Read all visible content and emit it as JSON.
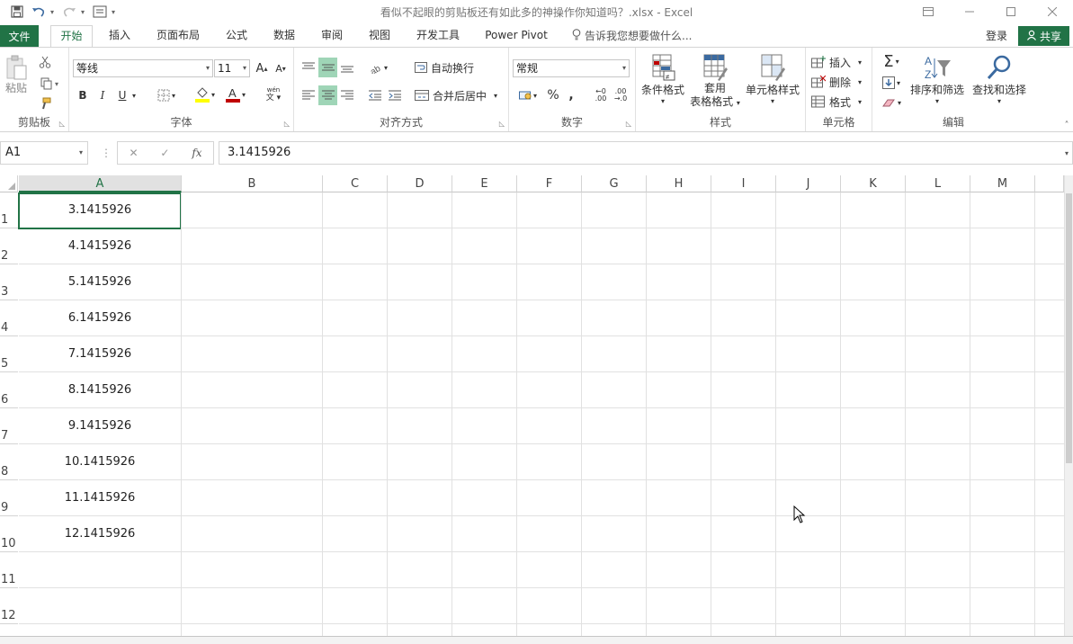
{
  "window": {
    "title": "看似不起眼的剪贴板还有如此多的神操作你知道吗？.xlsx - Excel"
  },
  "tabs": {
    "file": "文件",
    "items": [
      "开始",
      "插入",
      "页面布局",
      "公式",
      "数据",
      "审阅",
      "视图",
      "开发工具",
      "Power Pivot"
    ],
    "active_index": 0,
    "tell_me": "告诉我您想要做什么...",
    "login": "登录",
    "share": "共享"
  },
  "ribbon": {
    "clipboard": {
      "label": "剪贴板",
      "paste": "粘贴"
    },
    "font": {
      "label": "字体",
      "font_name": "等线",
      "font_size": "11"
    },
    "alignment": {
      "label": "对齐方式",
      "wrap_text": "自动换行",
      "merge_center": "合并后居中"
    },
    "number": {
      "label": "数字",
      "format": "常规"
    },
    "styles": {
      "label": "样式",
      "conditional_format": "条件格式",
      "format_as_table_1": "套用",
      "format_as_table_2": "表格格式",
      "cell_styles": "单元格样式"
    },
    "cells": {
      "label": "单元格",
      "insert": "插入",
      "delete": "删除",
      "format": "格式"
    },
    "editing": {
      "label": "编辑",
      "sort_filter": "排序和筛选",
      "find_select": "查找和选择"
    }
  },
  "formula_bar": {
    "name_box": "A1",
    "value": "3.1415926",
    "fx": "fx"
  },
  "sheet": {
    "columns": [
      "A",
      "B",
      "C",
      "D",
      "E",
      "F",
      "G",
      "H",
      "I",
      "J",
      "K",
      "L",
      "M"
    ],
    "rows": [
      "1",
      "2",
      "3",
      "4",
      "5",
      "6",
      "7",
      "8",
      "9",
      "10",
      "11",
      "12"
    ],
    "cells_A": [
      "3.1415926",
      "4.1415926",
      "5.1415926",
      "6.1415926",
      "7.1415926",
      "8.1415926",
      "9.1415926",
      "10.1415926",
      "11.1415926",
      "12.1415926",
      "",
      ""
    ],
    "selected_cell": "A1"
  },
  "colors": {
    "accent": "#217346",
    "selected_button": "#9fd5b7"
  }
}
